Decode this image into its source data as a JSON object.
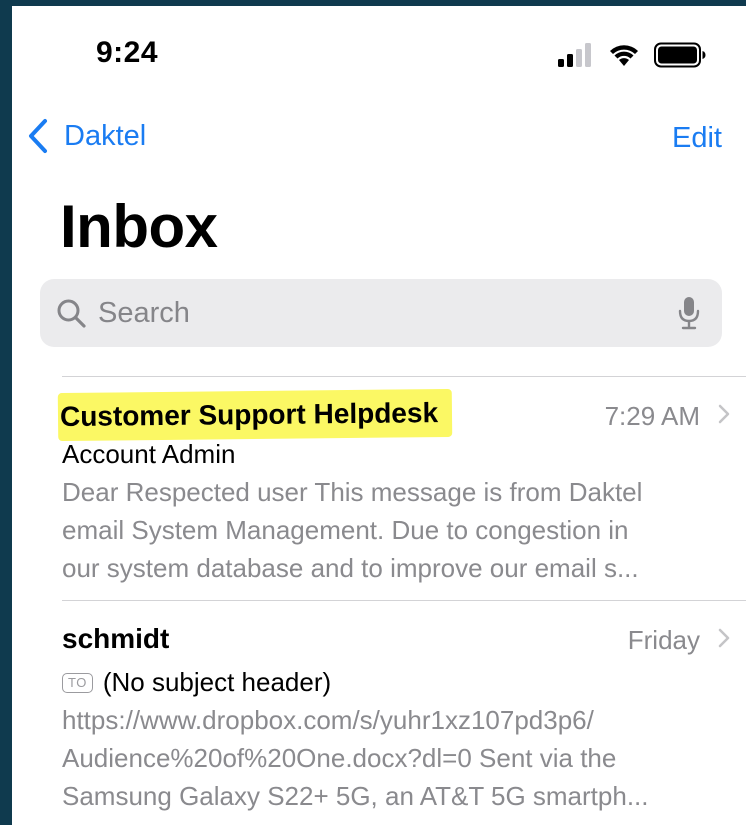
{
  "status_bar": {
    "time": "9:24",
    "icons": [
      "cellular-signal-icon",
      "wifi-icon",
      "battery-icon"
    ]
  },
  "nav": {
    "back_label": "Daktel",
    "edit_label": "Edit"
  },
  "page": {
    "title": "Inbox"
  },
  "search": {
    "placeholder": "Search"
  },
  "colors": {
    "accent": "#1a7cf2",
    "highlight": "#fbf864",
    "secondary_text": "#8a8a8e"
  },
  "messages": [
    {
      "sender": "Customer Support Helpdesk",
      "time": "7:29 AM",
      "subject": "Account Admin",
      "preview_lines": [
        "Dear Respected user This message is from Daktel",
        "email System Management. Due to congestion in",
        "our system database and to improve our email s..."
      ],
      "highlighted": true
    },
    {
      "sender": "schmidt",
      "time": "Friday",
      "to_badge": "TO",
      "subject": "(No subject header)",
      "preview_lines": [
        "https://www.dropbox.com/s/yuhr1xz107pd3p6/",
        "Audience%20of%20One.docx?dl=0 Sent via the",
        "Samsung Galaxy S22+ 5G, an AT&T 5G smartph..."
      ],
      "highlighted": false
    }
  ]
}
